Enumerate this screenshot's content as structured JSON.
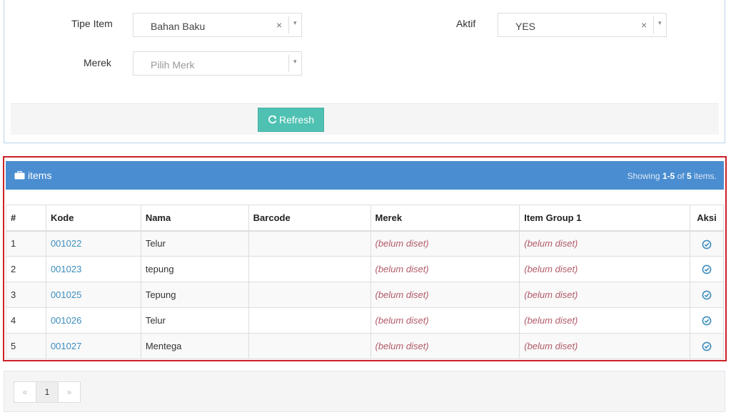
{
  "filters": {
    "tipe_item": {
      "label": "Tipe Item",
      "value": "Bahan Baku",
      "clear": "×"
    },
    "aktif": {
      "label": "Aktif",
      "value": "YES",
      "clear": "×"
    },
    "merek": {
      "label": "Merek",
      "placeholder": "Pilih Merk"
    },
    "arrow_glyph": "▾",
    "refresh_label": "Refresh"
  },
  "items": {
    "title": "items",
    "summary_prefix": "Showing ",
    "summary_range": "1-5",
    "summary_of": " of ",
    "summary_total": "5",
    "summary_suffix": " items.",
    "columns": [
      "#",
      "Kode",
      "Nama",
      "Barcode",
      "Merek",
      "Item Group 1",
      "Aksi"
    ],
    "rows": [
      {
        "no": "1",
        "kode": "001022",
        "nama": "Telur",
        "barcode": "",
        "merek": "(belum diset)",
        "group": "(belum diset)"
      },
      {
        "no": "2",
        "kode": "001023",
        "nama": "tepung",
        "barcode": "",
        "merek": "(belum diset)",
        "group": "(belum diset)"
      },
      {
        "no": "3",
        "kode": "001025",
        "nama": "Tepung",
        "barcode": "",
        "merek": "(belum diset)",
        "group": "(belum diset)"
      },
      {
        "no": "4",
        "kode": "001026",
        "nama": "Telur",
        "barcode": "",
        "merek": "(belum diset)",
        "group": "(belum diset)"
      },
      {
        "no": "5",
        "kode": "001027",
        "nama": "Mentega",
        "barcode": "",
        "merek": "(belum diset)",
        "group": "(belum diset)"
      }
    ]
  },
  "pagination": {
    "prev": "«",
    "page": "1",
    "next": "»"
  },
  "icons": {
    "refresh": "refresh-icon",
    "briefcase": "briefcase-icon",
    "action": "check-circle-icon"
  },
  "colors": {
    "header": "#4a8dd0",
    "refresh_button": "#4fc1b3",
    "highlight_border": "#cc2026",
    "link": "#3c8dbc",
    "unset_text": "#b25a68"
  }
}
